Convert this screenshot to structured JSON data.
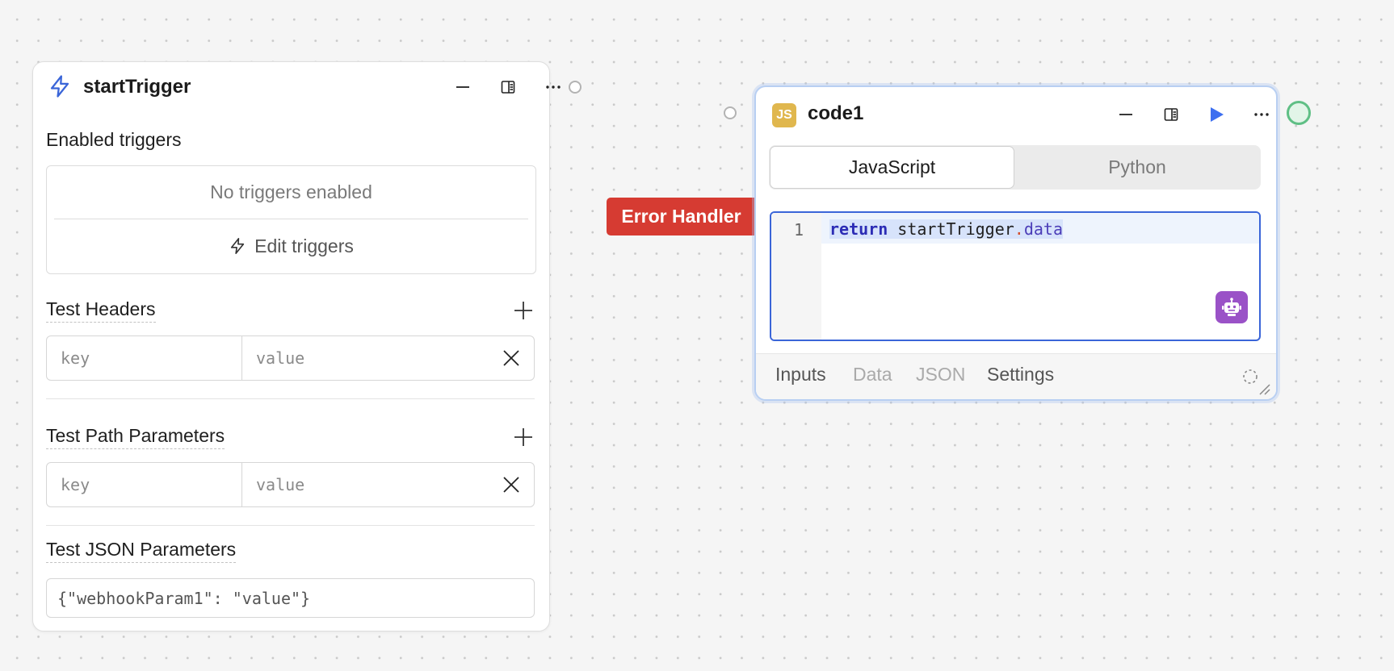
{
  "start_node": {
    "title": "startTrigger",
    "icon": "lightning-bolt-icon",
    "enabled_triggers_label": "Enabled triggers",
    "no_triggers_text": "No triggers enabled",
    "edit_triggers_label": "Edit triggers",
    "test_headers_label": "Test Headers",
    "test_path_params_label": "Test Path Parameters",
    "test_json_params_label": "Test JSON Parameters",
    "key_placeholder": "key",
    "value_placeholder": "value",
    "json_placeholder": "{\"webhookParam1\": \"value\"}"
  },
  "error_handler": {
    "label": "Error Handler",
    "color": "#d63b32"
  },
  "code_node": {
    "title": "code1",
    "badge": "JS",
    "tabs": [
      "JavaScript",
      "Python"
    ],
    "active_tab": "JavaScript",
    "line_number": "1",
    "code": {
      "keyword": "return",
      "identifier": "startTrigger",
      "dot": ".",
      "property": "data"
    },
    "bottom_tabs": [
      "Inputs",
      "Data",
      "JSON",
      "Settings"
    ],
    "bottom_tabs_enabled": [
      true,
      false,
      false,
      true
    ]
  },
  "colors": {
    "accent_blue": "#3a65d8",
    "run_button": "#3d6ff0",
    "output_handle": "#5fbf85",
    "ai_button": "#9a52c7"
  }
}
